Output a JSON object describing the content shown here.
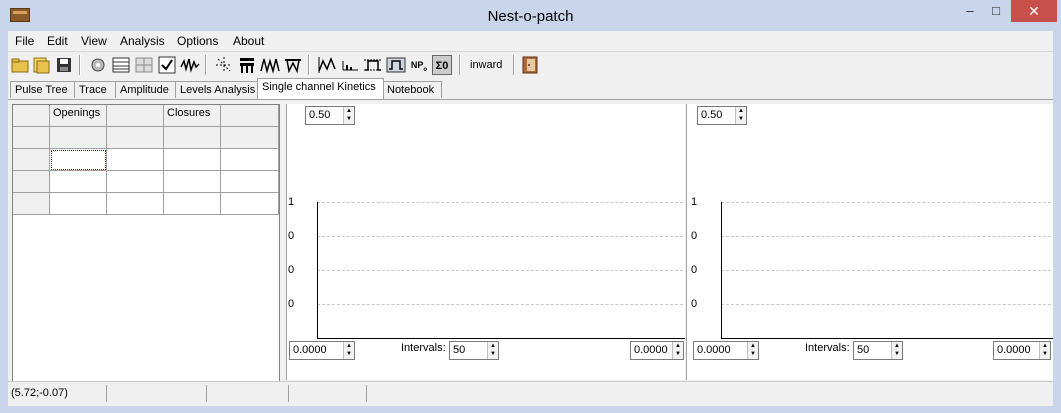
{
  "window": {
    "title": "Nest-o-patch",
    "min": "–",
    "max": "□",
    "close": "✕"
  },
  "menu": [
    "File",
    "Edit",
    "View",
    "Analysis",
    "Options",
    "About"
  ],
  "toolbar": {
    "groups": [
      [
        "open-icon",
        "open-file-icon",
        "save-icon"
      ],
      [
        "settings-icon",
        "table-icon",
        "grid-icon",
        "check-icon",
        "wave-icon"
      ],
      [
        "spark-icon",
        "comb-icon",
        "peaks-icon",
        "peaks-down-icon"
      ],
      [
        "trace-icon",
        "histogram-icon",
        "levels-icon",
        "step-icon",
        "np-icon",
        "sigma-icon"
      ]
    ],
    "inward_label": "inward",
    "exit_icon": "exit-door-icon"
  },
  "tabs": [
    "Pulse Tree",
    "Trace",
    "Amplitude",
    "Levels Analysis",
    "Single channel Kinetics",
    "Notebook"
  ],
  "active_tab": 4,
  "grid": {
    "headers": [
      "",
      "Openings",
      "",
      "Closures",
      ""
    ],
    "rows": [
      [
        "",
        "",
        "",
        "",
        ""
      ],
      [
        "",
        "",
        "",
        "",
        ""
      ],
      [
        "",
        "",
        "",
        "",
        ""
      ],
      [
        "",
        "",
        "",
        "",
        ""
      ]
    ]
  },
  "left_chart": {
    "scale": "0.50",
    "y_ticks": [
      "1",
      "0",
      "0",
      "0"
    ],
    "x_min": "0.0000",
    "x_max": "0.0000",
    "intervals_label": "Intervals:",
    "intervals": "50"
  },
  "right_chart": {
    "scale": "0.50",
    "y_ticks": [
      "1",
      "0",
      "0",
      "0"
    ],
    "x_min": "0.0000",
    "x_max": "0.0000",
    "intervals_label": "Intervals:",
    "intervals": "50"
  },
  "status": {
    "coords": "(5.72;-0.07)"
  },
  "colors": {
    "title_bg": "#c9d5ea",
    "close": "#c7504a"
  }
}
